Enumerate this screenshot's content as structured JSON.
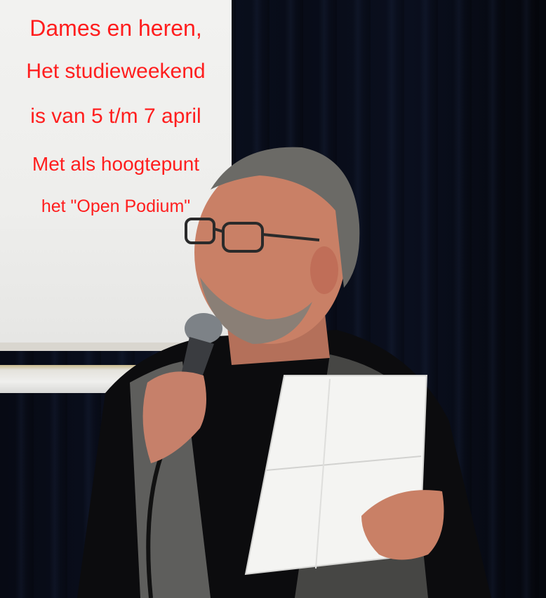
{
  "caption": {
    "line1": "Dames en heren,",
    "line2": "Het studieweekend",
    "line3": "is van 5 t/m 7 april",
    "line4": "Met als hoogtepunt",
    "line5": "het \"Open Podium\""
  },
  "colors": {
    "caption_text": "#ff1e1e",
    "screen": "#efefed",
    "curtain": "#0a0f1e"
  }
}
